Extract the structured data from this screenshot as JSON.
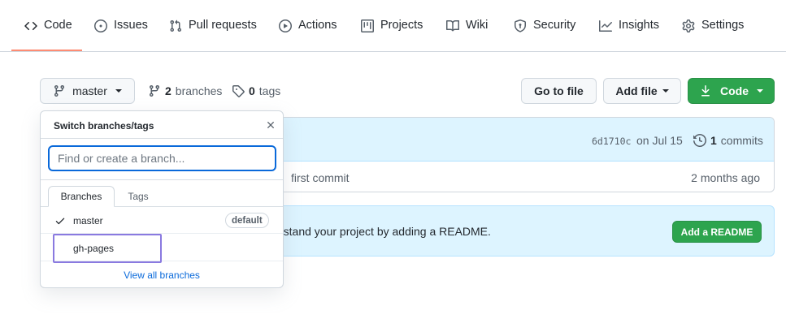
{
  "nav": {
    "tabs": [
      {
        "label": "Code",
        "icon": "code-icon",
        "active": true
      },
      {
        "label": "Issues",
        "icon": "issue-icon"
      },
      {
        "label": "Pull requests",
        "icon": "pull-request-icon"
      },
      {
        "label": "Actions",
        "icon": "play-icon"
      },
      {
        "label": "Projects",
        "icon": "project-icon"
      },
      {
        "label": "Wiki",
        "icon": "book-icon"
      },
      {
        "label": "Security",
        "icon": "shield-icon"
      },
      {
        "label": "Insights",
        "icon": "graph-icon"
      },
      {
        "label": "Settings",
        "icon": "gear-icon"
      }
    ]
  },
  "toolbar": {
    "branch_label": "master",
    "branches_count": "2",
    "branches_label": "branches",
    "tags_count": "0",
    "tags_label": "tags",
    "go_to_file": "Go to file",
    "add_file": "Add file",
    "code": "Code"
  },
  "commit": {
    "sha": "6d1710c",
    "date": "on Jul 15",
    "commits_count": "1",
    "commits_label": "commits",
    "file_message": "first commit",
    "file_age": "2 months ago"
  },
  "readme": {
    "text": "rstand your project by adding a README.",
    "button": "Add a README"
  },
  "dropdown": {
    "title": "Switch branches/tags",
    "search_placeholder": "Find or create a branch...",
    "tab_branches": "Branches",
    "tab_tags": "Tags",
    "branches": [
      {
        "name": "master",
        "badge": "default",
        "selected": true
      },
      {
        "name": "gh-pages"
      }
    ],
    "view_all": "View all branches"
  },
  "colors": {
    "accent_green": "#2da44e",
    "accent_blue": "#0969da",
    "nav_underline": "#fd8c73",
    "highlight": "#8a7ae0"
  }
}
